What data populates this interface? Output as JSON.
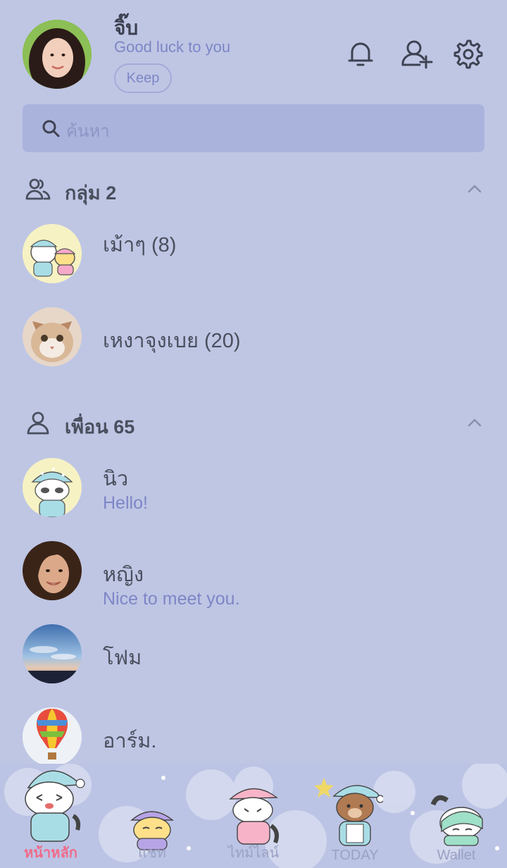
{
  "profile": {
    "name": "จิ๊บ",
    "status": "Good luck to you",
    "keep_label": "Keep"
  },
  "header_icons": [
    "bell-icon",
    "add-friend-icon",
    "settings-icon"
  ],
  "search": {
    "placeholder": "ค้นหา"
  },
  "groups": {
    "title": "กลุ่ม 2",
    "items": [
      {
        "name": "เม้าๆ (8)"
      },
      {
        "name": "เหงาจุงเบย (20)"
      }
    ]
  },
  "friends": {
    "title": "เพื่อน 65",
    "items": [
      {
        "name": "นิว",
        "message": "Hello!"
      },
      {
        "name": "หญิง",
        "message": "Nice to meet you."
      },
      {
        "name": "โฟม",
        "message": ""
      },
      {
        "name": "อาร์ม.",
        "message": ""
      }
    ]
  },
  "tabs": [
    {
      "label": "หน้าหลัก",
      "active": true
    },
    {
      "label": "แชท",
      "active": false
    },
    {
      "label": "ไทม์ไลน์",
      "active": false
    },
    {
      "label": "TODAY",
      "active": false
    },
    {
      "label": "Wallet",
      "active": false
    }
  ],
  "colors": {
    "background": "#bfc6e4",
    "accent": "#7d86c6",
    "active_tab": "#f06b8a"
  }
}
